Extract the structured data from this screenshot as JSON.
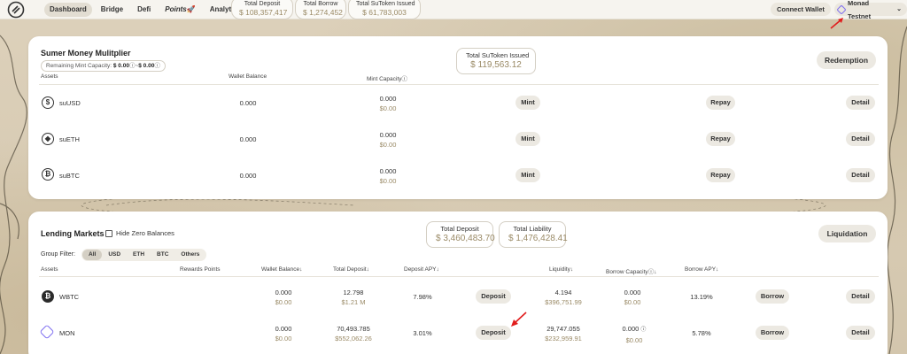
{
  "nav": {
    "items": [
      "Dashboard",
      "Bridge",
      "Defi",
      "Points",
      "Analytics"
    ],
    "active": "Dashboard"
  },
  "header_stats": [
    {
      "label": "Total Deposit",
      "value": "$ 108,357,417"
    },
    {
      "label": "Total Borrow",
      "value": "$ 1,274,452"
    },
    {
      "label": "Total SuToken Issued",
      "value": "$ 61,783,003"
    }
  ],
  "wallet": {
    "connect_label": "Connect Wallet",
    "network_label": "Monad Testnet",
    "network_icon": "diamond-icon"
  },
  "multiplier": {
    "title": "Sumer Money Mulitplier",
    "remaining_label": "Remaining Mint Capacity:",
    "remaining_value": "$ 0.00",
    "remaining_value2": "$ 0.00",
    "issued_label": "Total SuToken Issued",
    "issued_value": "$ 119,563.12",
    "redemption_label": "Redemption",
    "columns": {
      "assets": "Assets",
      "wallet": "Wallet Balance",
      "mint_capacity": "Mint Capacity"
    },
    "rows": [
      {
        "name": "suUSD",
        "icon": "$",
        "wallet": "0.000",
        "mint": "0.000",
        "mint_usd": "$0.00",
        "mint_btn": "Mint",
        "repay_btn": "Repay",
        "detail_btn": "Detail"
      },
      {
        "name": "suETH",
        "icon": "◆",
        "wallet": "0.000",
        "mint": "0.000",
        "mint_usd": "$0.00",
        "mint_btn": "Mint",
        "repay_btn": "Repay",
        "detail_btn": "Detail"
      },
      {
        "name": "suBTC",
        "icon": "₿",
        "wallet": "0.000",
        "mint": "0.000",
        "mint_usd": "$0.00",
        "mint_btn": "Mint",
        "repay_btn": "Repay",
        "detail_btn": "Detail"
      }
    ]
  },
  "lending": {
    "title": "Lending Markets",
    "hide_zero_label": "Hide Zero Balances",
    "total_deposit_label": "Total Deposit",
    "total_deposit_value": "$ 3,460,483.70",
    "total_liability_label": "Total Liability",
    "total_liability_value": "$ 1,476,428.41",
    "liquidation_label": "Liquidation",
    "group_filter_label": "Group Filter:",
    "filters": [
      "All",
      "USD",
      "ETH",
      "BTC",
      "Others"
    ],
    "active_filter": "All",
    "columns": {
      "assets": "Assets",
      "rewards": "Rewards Points",
      "wallet": "Wallet Balance",
      "total_deposit": "Total Deposit",
      "deposit_apy": "Deposit APY",
      "liquidity": "Liquidity",
      "borrow_capacity": "Borrow Capacity",
      "borrow_apy": "Borrow APY"
    },
    "rows": [
      {
        "name": "WBTC",
        "wallet": "0.000",
        "wallet_usd": "$0.00",
        "deposit": "12.798",
        "deposit_usd": "$1.21 M",
        "deposit_apy": "7.98%",
        "deposit_btn": "Deposit",
        "liquidity": "4.194",
        "liquidity_usd": "$396,751.99",
        "borrow_cap": "0.000",
        "borrow_cap_usd": "$0.00",
        "borrow_apy": "13.19%",
        "borrow_btn": "Borrow",
        "detail_btn": "Detail"
      },
      {
        "name": "MON",
        "wallet": "0.000",
        "wallet_usd": "$0.00",
        "deposit": "70,493.785",
        "deposit_usd": "$552,062.26",
        "deposit_apy": "3.01%",
        "deposit_btn": "Deposit",
        "liquidity": "29,747.055",
        "liquidity_usd": "$232,959.91",
        "borrow_cap": "0.000",
        "borrow_cap_usd": "$0.00",
        "borrow_apy": "5.78%",
        "borrow_btn": "Borrow",
        "detail_btn": "Detail"
      }
    ]
  },
  "colors": {
    "accent_gold": "#9a8a66",
    "button_bg": "#ece9e2",
    "monad_purple": "#7c6cf0",
    "arrow_red": "#e11d1d"
  }
}
